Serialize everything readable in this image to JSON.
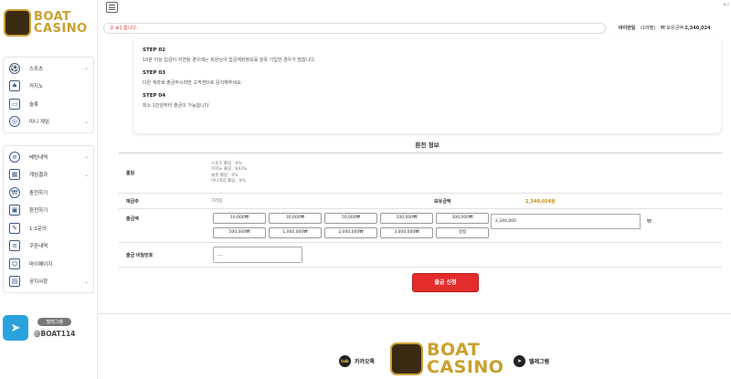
{
  "brand": {
    "line1": "BOAT",
    "line2": "CASINO"
  },
  "sidebar": {
    "menu1": [
      {
        "label": "스포츠",
        "icon": "soccer-ball-icon",
        "glyph": "⚽",
        "chev": true
      },
      {
        "label": "카지노",
        "icon": "cards-icon",
        "glyph": "♠",
        "chev": false
      },
      {
        "label": "슬롯",
        "icon": "slot-machine-icon",
        "glyph": "▭",
        "chev": false
      },
      {
        "label": "미니 게임",
        "icon": "minigame-icon",
        "glyph": "◎",
        "chev": true
      }
    ],
    "menu2": [
      {
        "label": "베팅내역",
        "icon": "document-icon",
        "glyph": "≡",
        "chev": true
      },
      {
        "label": "게임결과",
        "icon": "calendar-icon",
        "glyph": "▦",
        "chev": true
      },
      {
        "label": "충전하기",
        "icon": "coin-icon",
        "glyph": "₩",
        "chev": false
      },
      {
        "label": "환전하기",
        "icon": "wallet-icon",
        "glyph": "▣",
        "chev": false
      },
      {
        "label": "1:1문의",
        "icon": "pencil-icon",
        "glyph": "✎",
        "chev": false
      },
      {
        "label": "쿠폰내역",
        "icon": "coupon-icon",
        "glyph": "≡",
        "chev": false
      },
      {
        "label": "마이페이지",
        "icon": "user-icon",
        "glyph": "☺",
        "chev": false
      },
      {
        "label": "공지사항",
        "icon": "gift-icon",
        "glyph": "▤",
        "chev": true
      }
    ],
    "telegram": {
      "badge": "텔레그램",
      "id": "@BOAT114"
    }
  },
  "topbar": {
    "ticker": "오 ⊕1 합니다.",
    "tiny": "로그",
    "user_name": "바이반일",
    "level": "(1레벨)",
    "points_label": "₩ 보유금액",
    "points_value": "2,340,024"
  },
  "steps": [
    {
      "title": "STEP 02",
      "desc": "10분 이상 입금이 지연될 경우에는 회원님의 입금계좌정보를 잘못 기입한 경우가 많습니다."
    },
    {
      "title": "STEP 03",
      "desc": "다른 계좌로 출금하시려면 고객센터로 문의해주세요."
    },
    {
      "title": "STEP 04",
      "desc": "최소 1만원부터 출금이 가능합니다"
    }
  ],
  "form": {
    "title": "환전 정보",
    "rolling_label": "롤링",
    "rolling_lines": [
      "스포츠 롤링 : 0%",
      "카지노 롤링 : 643%",
      "슬롯 롤링 : 0%",
      "미니게임 롤링 : 0%"
    ],
    "depositor_label": "예금주",
    "depositor_value": "가려짐",
    "balance_label": "보유금액",
    "balance_value": "2,340,024원",
    "amount_label": "출금액",
    "amount_buttons": [
      "10,000₩",
      "30,000₩",
      "50,000₩",
      "100,000₩",
      "300,000₩",
      "500,000₩",
      "1,000,000₩",
      "2,000,000₩",
      "3,000,000₩",
      "정정"
    ],
    "amount_value": "2,340,000",
    "won": "₩",
    "password_label": "출금 비밀번호",
    "password_value": "....",
    "submit": "출금 신청"
  },
  "footer": {
    "kakao_label": "카카오톡",
    "kakao_dot": "talk",
    "telegram_label": "텔레그램",
    "brand1": "BOAT",
    "brand2": "CASINO"
  },
  "colors": {
    "accent": "#e32d2d",
    "gold": "#c9a02e",
    "balance": "#c58a10",
    "ticker": "#e03a3a"
  }
}
